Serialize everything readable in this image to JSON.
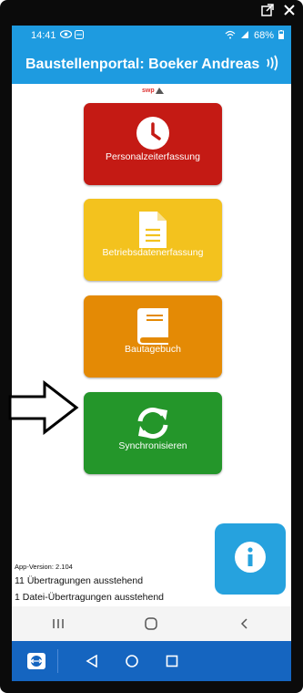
{
  "status_bar": {
    "time": "14:41",
    "battery": "68%",
    "icons": [
      "eye-icon",
      "teamviewer-small-icon",
      "wifi-icon",
      "signal-icon",
      "battery-icon"
    ]
  },
  "app_bar": {
    "title": "Baustellenportal: Boeker Andreas",
    "nfc_icon": "nfc-icon"
  },
  "logo": {
    "text": "swp"
  },
  "tiles": [
    {
      "label": "Personalzeiterfassung",
      "icon": "clock-icon",
      "color": "#c41a14"
    },
    {
      "label": "Betriebsdatenerfassung",
      "icon": "document-icon",
      "color": "#f3c21e"
    },
    {
      "label": "Bautagebuch",
      "icon": "book-icon",
      "color": "#e48a05"
    },
    {
      "label": "Synchronisieren",
      "icon": "sync-icon",
      "color": "#24962a"
    }
  ],
  "footer": {
    "version": "App-Version: 2.104",
    "pending_transfers": "11 Übertragungen ausstehend",
    "pending_files": "1 Datei-Übertragungen ausstehend"
  },
  "info_button": {
    "icon": "info-icon",
    "color": "#26a2de"
  },
  "android_nav": {
    "icons": [
      "recents-icon",
      "home-icon",
      "back-icon"
    ]
  },
  "remote_bar": {
    "icons": [
      "teamviewer-icon",
      "triangle-back-icon",
      "circle-home-icon",
      "square-recents-icon"
    ]
  },
  "window_controls": {
    "icons": [
      "popout-icon",
      "close-icon"
    ]
  }
}
